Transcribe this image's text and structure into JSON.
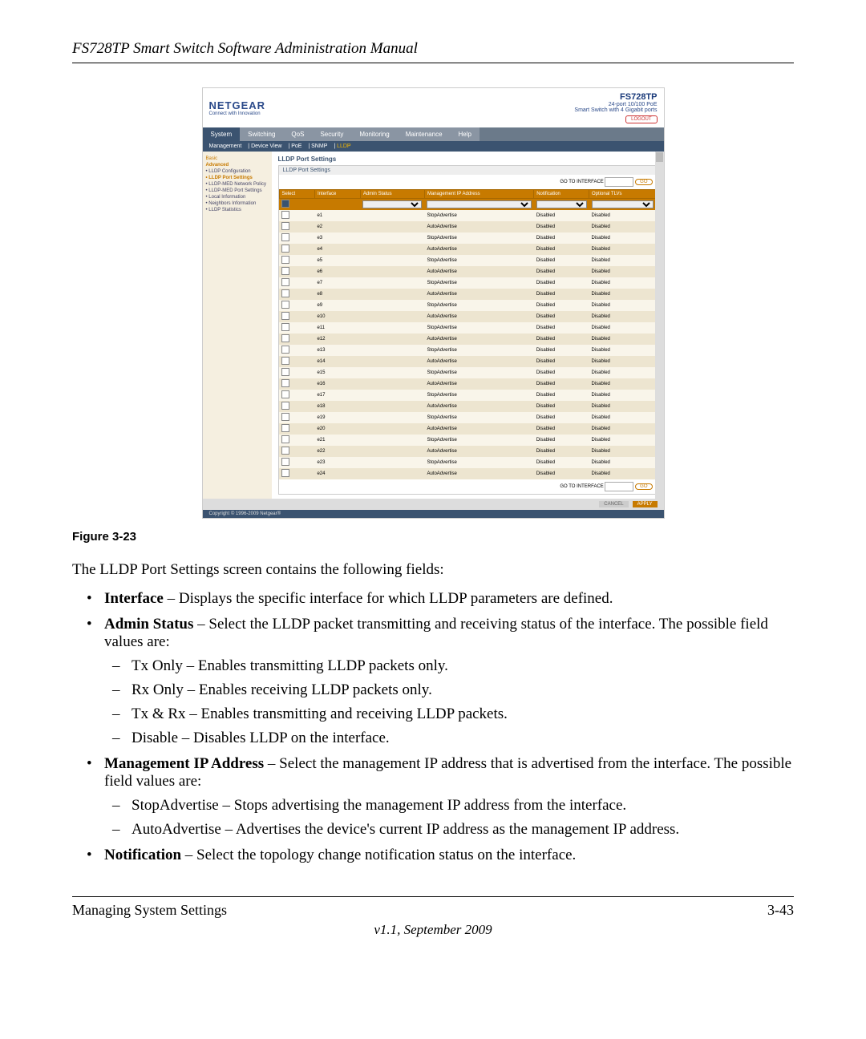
{
  "header": "FS728TP Smart Switch Software Administration Manual",
  "brand": {
    "name": "NETGEAR",
    "tagline": "Connect with Innovation"
  },
  "product": {
    "model": "FS728TP",
    "desc": "24-port 10/100 PoE\nSmart Switch with 4 Gigabit ports"
  },
  "logout": "LOGOUT",
  "tabs": [
    "System",
    "Switching",
    "QoS",
    "Security",
    "Monitoring",
    "Maintenance",
    "Help"
  ],
  "active_tab": "System",
  "subtabs": [
    "Management",
    "Device View",
    "PoE",
    "SNMP",
    "LLDP"
  ],
  "active_subtab": "LLDP",
  "sidebar": [
    "Basic",
    "Advanced",
    "• LLDP Configuration",
    "• LLDP Port Settings",
    "• LLDP-MED Network Policy",
    "• LLDP-MED Port Settings",
    "• Local Information",
    "• Neighbors Information",
    "• LLDP Statistics"
  ],
  "panel_title": "LLDP Port Settings",
  "panel_box_title": "LLDP Port Settings",
  "goto_label": "GO TO INTERFACE",
  "go_btn": "GO",
  "columns": [
    "Select",
    "Interface",
    "Admin Status",
    "Management IP Address",
    "Notification",
    "Optional TLVs"
  ],
  "rows": [
    {
      "i": "e1",
      "m": "StopAdvertise",
      "n": "Disabled",
      "t": "Disabled"
    },
    {
      "i": "e2",
      "m": "AutoAdvertise",
      "n": "Disabled",
      "t": "Disabled"
    },
    {
      "i": "e3",
      "m": "StopAdvertise",
      "n": "Disabled",
      "t": "Disabled"
    },
    {
      "i": "e4",
      "m": "AutoAdvertise",
      "n": "Disabled",
      "t": "Disabled"
    },
    {
      "i": "e5",
      "m": "StopAdvertise",
      "n": "Disabled",
      "t": "Disabled"
    },
    {
      "i": "e6",
      "m": "AutoAdvertise",
      "n": "Disabled",
      "t": "Disabled"
    },
    {
      "i": "e7",
      "m": "StopAdvertise",
      "n": "Disabled",
      "t": "Disabled"
    },
    {
      "i": "e8",
      "m": "AutoAdvertise",
      "n": "Disabled",
      "t": "Disabled"
    },
    {
      "i": "e9",
      "m": "StopAdvertise",
      "n": "Disabled",
      "t": "Disabled"
    },
    {
      "i": "e10",
      "m": "AutoAdvertise",
      "n": "Disabled",
      "t": "Disabled"
    },
    {
      "i": "e11",
      "m": "StopAdvertise",
      "n": "Disabled",
      "t": "Disabled"
    },
    {
      "i": "e12",
      "m": "AutoAdvertise",
      "n": "Disabled",
      "t": "Disabled"
    },
    {
      "i": "e13",
      "m": "StopAdvertise",
      "n": "Disabled",
      "t": "Disabled"
    },
    {
      "i": "e14",
      "m": "AutoAdvertise",
      "n": "Disabled",
      "t": "Disabled"
    },
    {
      "i": "e15",
      "m": "StopAdvertise",
      "n": "Disabled",
      "t": "Disabled"
    },
    {
      "i": "e16",
      "m": "AutoAdvertise",
      "n": "Disabled",
      "t": "Disabled"
    },
    {
      "i": "e17",
      "m": "StopAdvertise",
      "n": "Disabled",
      "t": "Disabled"
    },
    {
      "i": "e18",
      "m": "AutoAdvertise",
      "n": "Disabled",
      "t": "Disabled"
    },
    {
      "i": "e19",
      "m": "StopAdvertise",
      "n": "Disabled",
      "t": "Disabled"
    },
    {
      "i": "e20",
      "m": "AutoAdvertise",
      "n": "Disabled",
      "t": "Disabled"
    },
    {
      "i": "e21",
      "m": "StopAdvertise",
      "n": "Disabled",
      "t": "Disabled"
    },
    {
      "i": "e22",
      "m": "AutoAdvertise",
      "n": "Disabled",
      "t": "Disabled"
    },
    {
      "i": "e23",
      "m": "StopAdvertise",
      "n": "Disabled",
      "t": "Disabled"
    },
    {
      "i": "e24",
      "m": "AutoAdvertise",
      "n": "Disabled",
      "t": "Disabled"
    }
  ],
  "cancel": "CANCEL",
  "apply": "APPLY",
  "copyright": "Copyright © 1996-2009 Netgear®",
  "figure": "Figure 3-23",
  "intro": "The LLDP Port Settings screen contains the following fields:",
  "b": [
    {
      "t": "Interface",
      "d": " – Displays the specific interface for which LLDP parameters are defined."
    },
    {
      "t": "Admin Status",
      "d": " – Select the LLDP packet transmitting and receiving status of the interface. The possible field values are:",
      "s": [
        "Tx Only – Enables transmitting LLDP packets only.",
        "Rx Only – Enables receiving LLDP packets only.",
        "Tx & Rx – Enables transmitting and receiving LLDP packets.",
        "Disable – Disables LLDP on the interface."
      ]
    },
    {
      "t": "Management IP Address",
      "d": " – Select the management IP address that is advertised from the interface. The possible field values are:",
      "s": [
        "StopAdvertise – Stops advertising the management IP address from the interface.",
        "AutoAdvertise – Advertises the device's current IP address as the management IP address."
      ]
    },
    {
      "t": "Notification",
      "d": " – Select the topology change notification status on the interface."
    }
  ],
  "footer": {
    "left": "Managing System Settings",
    "right": "3-43",
    "ver": "v1.1, September 2009"
  }
}
